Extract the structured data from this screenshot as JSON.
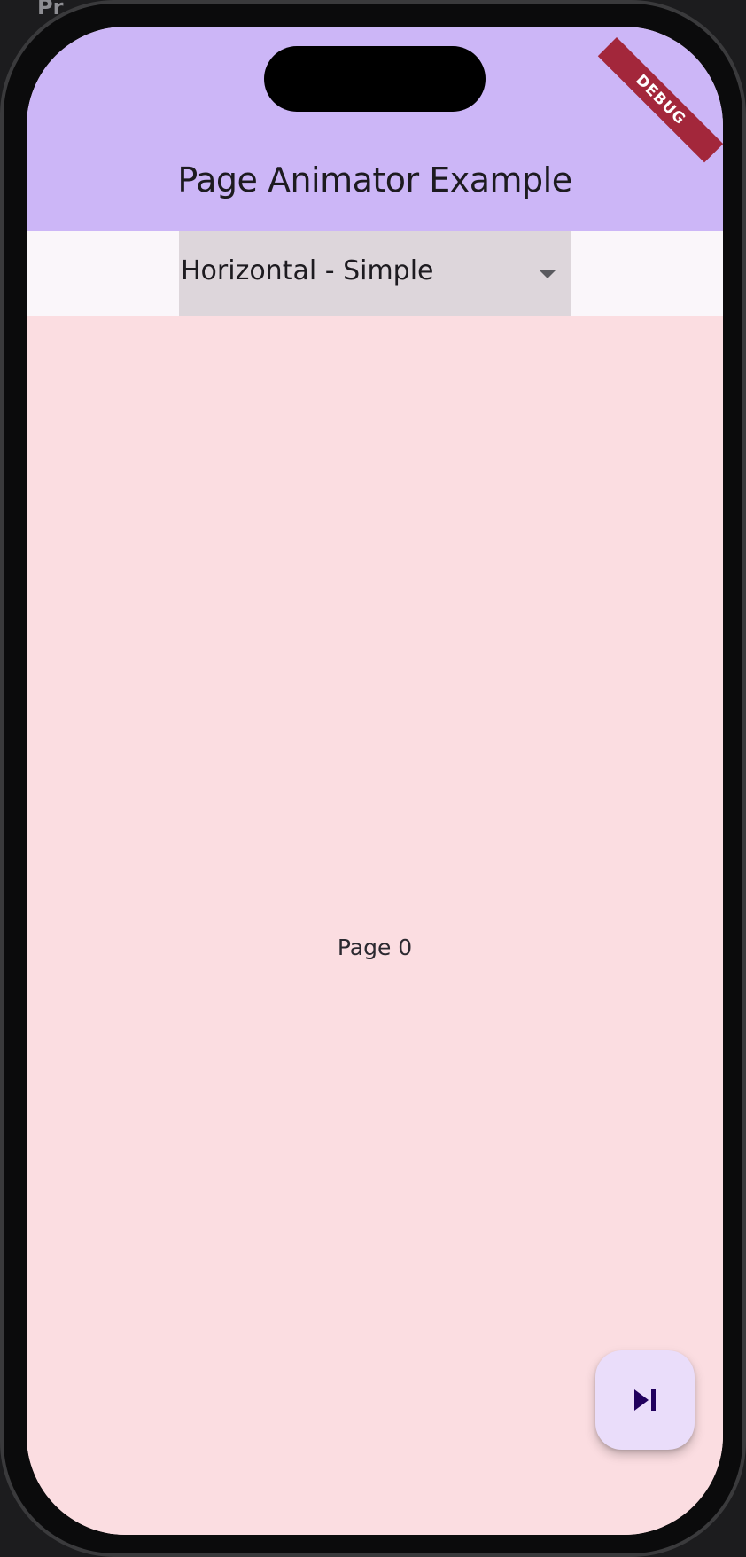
{
  "backdrop": {
    "label": "Pr"
  },
  "status": {
    "debug_banner": "DEBUG"
  },
  "app_bar": {
    "title": "Page Animator Example"
  },
  "dropdown": {
    "selected": "Horizontal - Simple"
  },
  "page": {
    "label": "Page 0"
  },
  "fab": {
    "icon": "skip-next-icon"
  },
  "colors": {
    "app_bar": "#ccb6f7",
    "page_background": "#fbdde1",
    "dropdown_background": "#ddd6db",
    "fab_background": "#eaddfa",
    "debug_banner": "#a3273b"
  }
}
